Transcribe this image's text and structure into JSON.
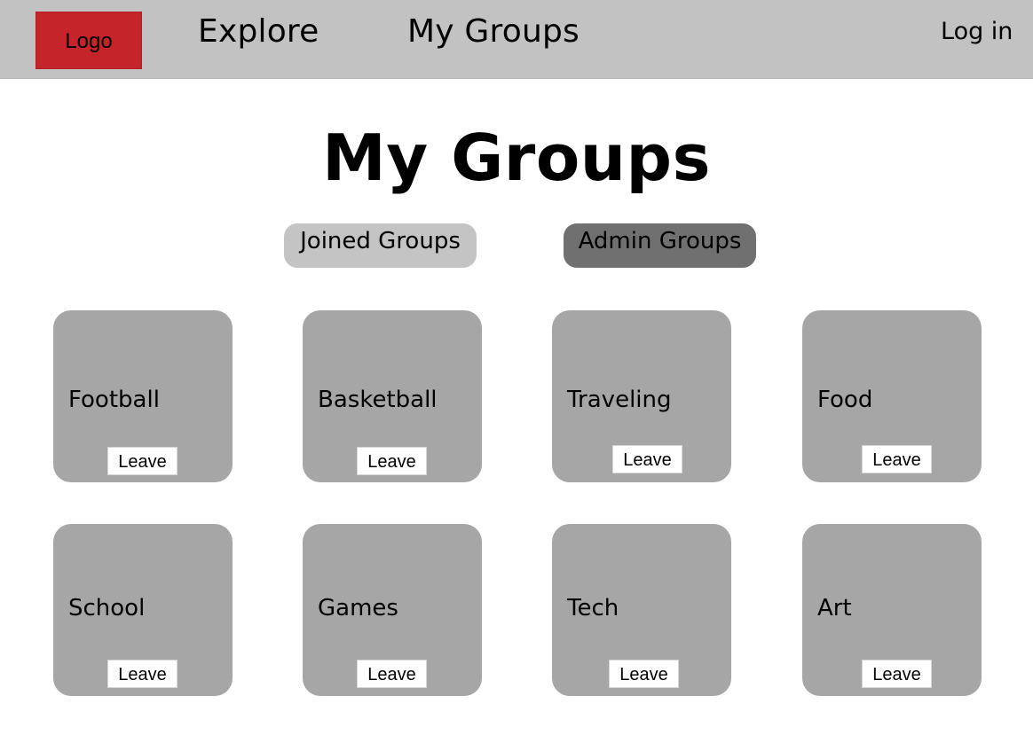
{
  "navbar": {
    "logo": "Logo",
    "links": [
      "Explore",
      "My Groups"
    ],
    "login": "Log in"
  },
  "page": {
    "title": "My Groups"
  },
  "tabs": [
    {
      "label": "Joined Groups",
      "state": "inactive"
    },
    {
      "label": "Admin Groups",
      "state": "active"
    }
  ],
  "groups": [
    {
      "name": "Football",
      "button": "Leave"
    },
    {
      "name": "Basketball",
      "button": "Leave"
    },
    {
      "name": "Traveling",
      "button": "Leave"
    },
    {
      "name": "Food",
      "button": "Leave"
    },
    {
      "name": "School",
      "button": "Leave"
    },
    {
      "name": "Games",
      "button": "Leave"
    },
    {
      "name": "Tech",
      "button": "Leave"
    },
    {
      "name": "Art",
      "button": "Leave"
    }
  ],
  "colors": {
    "navbar_bg": "#c2c2c2",
    "logo_bg": "#c4242a",
    "tab_inactive": "#c4c4c4",
    "tab_active": "#707070",
    "card_bg": "#a6a6a6",
    "button_bg": "#ffffff"
  }
}
